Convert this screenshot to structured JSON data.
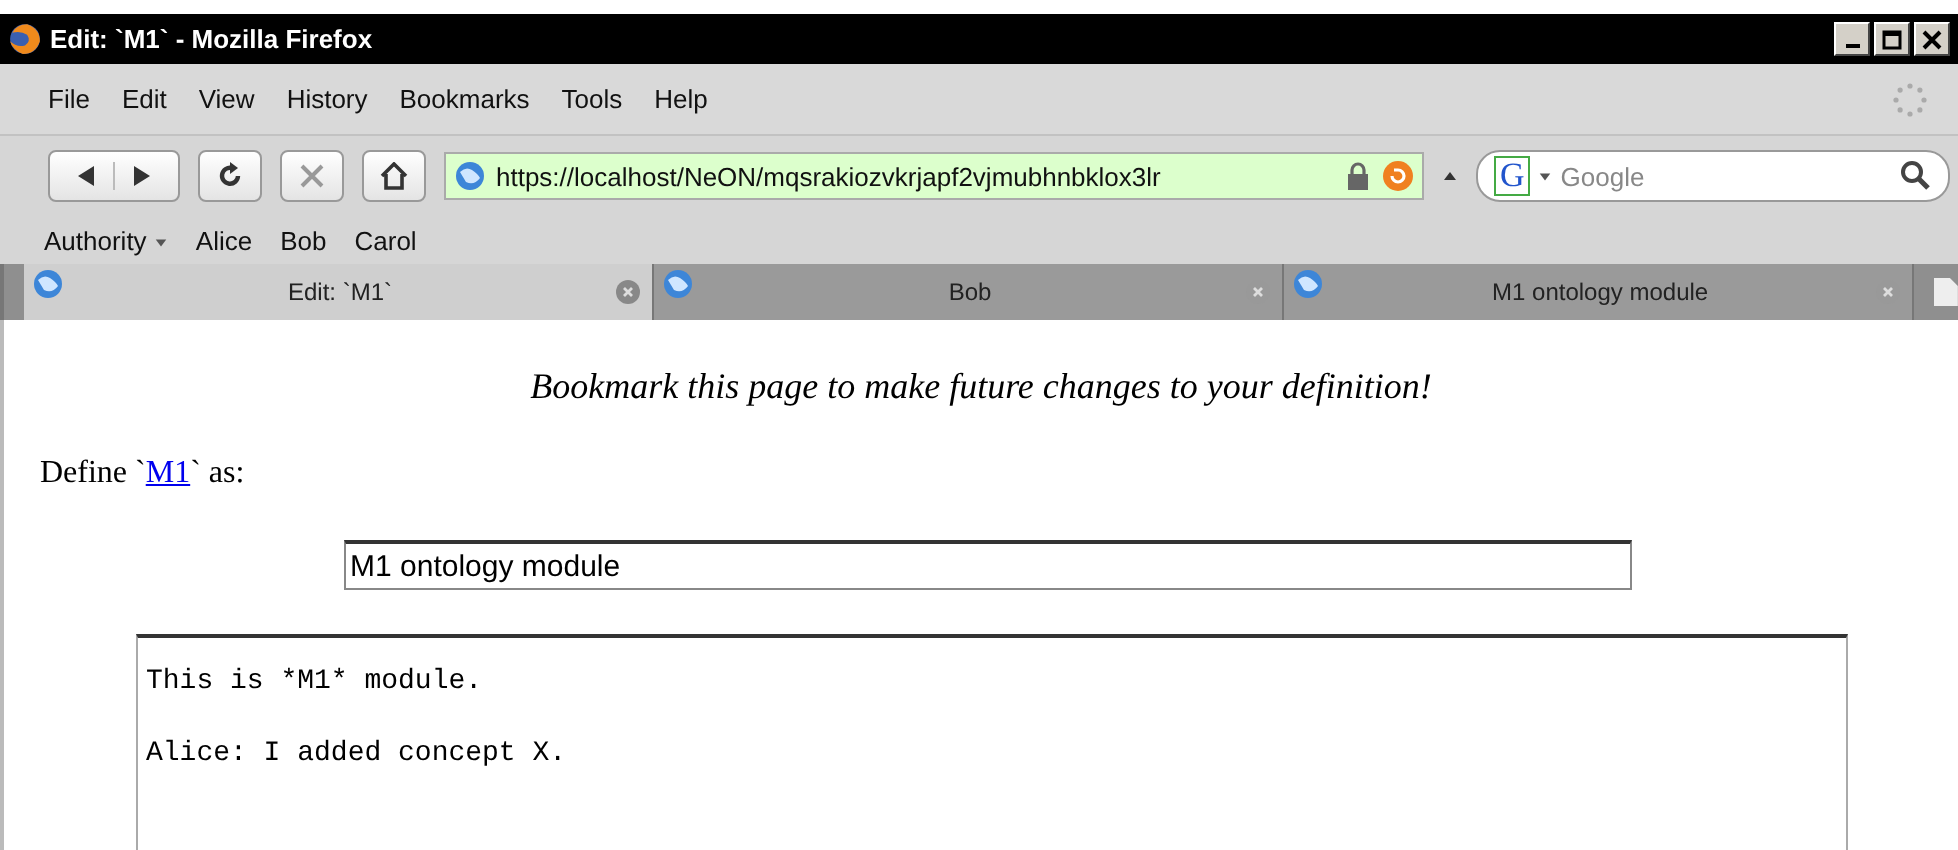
{
  "window": {
    "title": "Edit: `M1` - Mozilla Firefox"
  },
  "menu": [
    "File",
    "Edit",
    "View",
    "History",
    "Bookmarks",
    "Tools",
    "Help"
  ],
  "address": {
    "value": "https://localhost/NeON/mqsrakiozvkrjapf2vjmubhnbklox3lr"
  },
  "search": {
    "engine_logo": "G",
    "placeholder": "Google"
  },
  "bookmarks": [
    {
      "label": "Authority",
      "kind": "folder"
    },
    {
      "label": "Alice",
      "kind": "link"
    },
    {
      "label": "Bob",
      "kind": "link"
    },
    {
      "label": "Carol",
      "kind": "link"
    }
  ],
  "tabs": [
    {
      "label": "Edit: `M1`",
      "selected": true
    },
    {
      "label": "Bob",
      "selected": false
    },
    {
      "label": "M1 ontology module",
      "selected": false
    }
  ],
  "page": {
    "notice": "Bookmark this page to make future changes to your definition!",
    "define_prefix": "Define `",
    "define_link": "M1",
    "define_suffix": "` as:",
    "title_field": "M1 ontology module",
    "body_lines": [
      "This is *M1* module.",
      "Alice: I added concept X."
    ]
  }
}
